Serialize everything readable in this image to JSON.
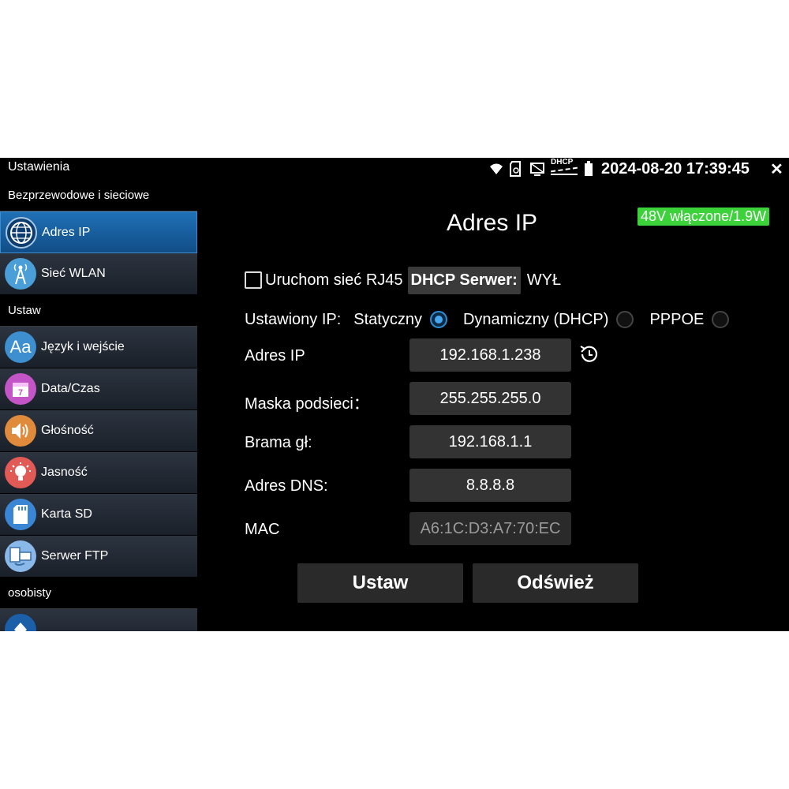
{
  "status_bar": {
    "app_title": "Ustawienia",
    "datetime": "2024-08-20 17:39:45",
    "dhcp_icon_label": "DHCP",
    "icons": [
      "wifi-icon",
      "sd-card-icon",
      "monitor-icon",
      "dhcp-icon",
      "battery-icon"
    ],
    "close_label": "✕"
  },
  "sidebar": {
    "sections": [
      {
        "header": "Bezprzewodowe i sieciowe",
        "items": [
          {
            "label": "Adres IP",
            "icon": "globe-icon",
            "active": true
          },
          {
            "label": "Sieć WLAN",
            "icon": "antenna-icon",
            "active": false
          }
        ]
      },
      {
        "header": "Ustaw",
        "items": [
          {
            "label": "Język i wejście",
            "icon": "language-icon",
            "active": false
          },
          {
            "label": "Data/Czas",
            "icon": "calendar-icon",
            "active": false
          },
          {
            "label": "Głośność",
            "icon": "volume-icon",
            "active": false
          },
          {
            "label": "Jasność",
            "icon": "brightness-icon",
            "active": false
          },
          {
            "label": "Karta SD",
            "icon": "sd-card-icon",
            "active": false
          },
          {
            "label": "Serwer FTP",
            "icon": "ftp-icon",
            "active": false
          }
        ]
      },
      {
        "header": "osobisty",
        "items": []
      }
    ]
  },
  "main": {
    "title": "Adres IP",
    "poe_status": "48V włączone/1.9W",
    "rj45_label": "Uruchom sieć RJ45",
    "rj45_checked": false,
    "dhcp_server_label": "DHCP Serwer:",
    "dhcp_server_state": "WYŁ",
    "ip_mode_label": "Ustawiony IP:",
    "ip_modes": [
      {
        "label": "Statyczny",
        "selected": true
      },
      {
        "label": "Dynamiczny (DHCP)",
        "selected": false
      },
      {
        "label": "PPPOE",
        "selected": false
      }
    ],
    "fields": {
      "ip": {
        "label": "Adres IP",
        "value": "192.168.1.238"
      },
      "mask": {
        "label": "Maska podsieci：",
        "value": "255.255.255.0"
      },
      "gateway": {
        "label": "Brama gł:",
        "value": "192.168.1.1"
      },
      "dns": {
        "label": "Adres DNS:",
        "value": "8.8.8.8"
      },
      "mac": {
        "label": "MAC",
        "value": "A6:1C:D3:A7:70:EC"
      }
    },
    "buttons": {
      "set": "Ustaw",
      "refresh": "Odśwież"
    }
  },
  "colors": {
    "background": "#000000",
    "active_item": "#1565a8",
    "poe_badge": "#3bd23a",
    "input_bg": "#333333",
    "radio_selected": "#47a8f0"
  }
}
